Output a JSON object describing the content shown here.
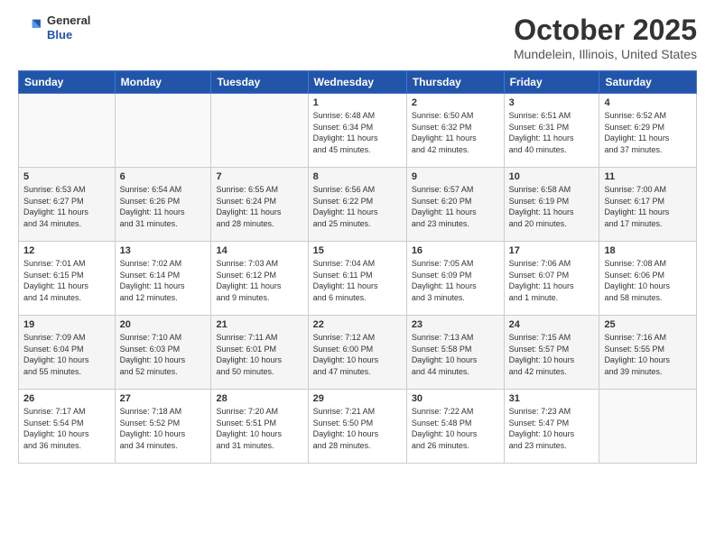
{
  "header": {
    "logo_general": "General",
    "logo_blue": "Blue",
    "month_title": "October 2025",
    "location": "Mundelein, Illinois, United States"
  },
  "days_of_week": [
    "Sunday",
    "Monday",
    "Tuesday",
    "Wednesday",
    "Thursday",
    "Friday",
    "Saturday"
  ],
  "weeks": [
    [
      {
        "day": "",
        "info": ""
      },
      {
        "day": "",
        "info": ""
      },
      {
        "day": "",
        "info": ""
      },
      {
        "day": "1",
        "info": "Sunrise: 6:48 AM\nSunset: 6:34 PM\nDaylight: 11 hours\nand 45 minutes."
      },
      {
        "day": "2",
        "info": "Sunrise: 6:50 AM\nSunset: 6:32 PM\nDaylight: 11 hours\nand 42 minutes."
      },
      {
        "day": "3",
        "info": "Sunrise: 6:51 AM\nSunset: 6:31 PM\nDaylight: 11 hours\nand 40 minutes."
      },
      {
        "day": "4",
        "info": "Sunrise: 6:52 AM\nSunset: 6:29 PM\nDaylight: 11 hours\nand 37 minutes."
      }
    ],
    [
      {
        "day": "5",
        "info": "Sunrise: 6:53 AM\nSunset: 6:27 PM\nDaylight: 11 hours\nand 34 minutes."
      },
      {
        "day": "6",
        "info": "Sunrise: 6:54 AM\nSunset: 6:26 PM\nDaylight: 11 hours\nand 31 minutes."
      },
      {
        "day": "7",
        "info": "Sunrise: 6:55 AM\nSunset: 6:24 PM\nDaylight: 11 hours\nand 28 minutes."
      },
      {
        "day": "8",
        "info": "Sunrise: 6:56 AM\nSunset: 6:22 PM\nDaylight: 11 hours\nand 25 minutes."
      },
      {
        "day": "9",
        "info": "Sunrise: 6:57 AM\nSunset: 6:20 PM\nDaylight: 11 hours\nand 23 minutes."
      },
      {
        "day": "10",
        "info": "Sunrise: 6:58 AM\nSunset: 6:19 PM\nDaylight: 11 hours\nand 20 minutes."
      },
      {
        "day": "11",
        "info": "Sunrise: 7:00 AM\nSunset: 6:17 PM\nDaylight: 11 hours\nand 17 minutes."
      }
    ],
    [
      {
        "day": "12",
        "info": "Sunrise: 7:01 AM\nSunset: 6:15 PM\nDaylight: 11 hours\nand 14 minutes."
      },
      {
        "day": "13",
        "info": "Sunrise: 7:02 AM\nSunset: 6:14 PM\nDaylight: 11 hours\nand 12 minutes."
      },
      {
        "day": "14",
        "info": "Sunrise: 7:03 AM\nSunset: 6:12 PM\nDaylight: 11 hours\nand 9 minutes."
      },
      {
        "day": "15",
        "info": "Sunrise: 7:04 AM\nSunset: 6:11 PM\nDaylight: 11 hours\nand 6 minutes."
      },
      {
        "day": "16",
        "info": "Sunrise: 7:05 AM\nSunset: 6:09 PM\nDaylight: 11 hours\nand 3 minutes."
      },
      {
        "day": "17",
        "info": "Sunrise: 7:06 AM\nSunset: 6:07 PM\nDaylight: 11 hours\nand 1 minute."
      },
      {
        "day": "18",
        "info": "Sunrise: 7:08 AM\nSunset: 6:06 PM\nDaylight: 10 hours\nand 58 minutes."
      }
    ],
    [
      {
        "day": "19",
        "info": "Sunrise: 7:09 AM\nSunset: 6:04 PM\nDaylight: 10 hours\nand 55 minutes."
      },
      {
        "day": "20",
        "info": "Sunrise: 7:10 AM\nSunset: 6:03 PM\nDaylight: 10 hours\nand 52 minutes."
      },
      {
        "day": "21",
        "info": "Sunrise: 7:11 AM\nSunset: 6:01 PM\nDaylight: 10 hours\nand 50 minutes."
      },
      {
        "day": "22",
        "info": "Sunrise: 7:12 AM\nSunset: 6:00 PM\nDaylight: 10 hours\nand 47 minutes."
      },
      {
        "day": "23",
        "info": "Sunrise: 7:13 AM\nSunset: 5:58 PM\nDaylight: 10 hours\nand 44 minutes."
      },
      {
        "day": "24",
        "info": "Sunrise: 7:15 AM\nSunset: 5:57 PM\nDaylight: 10 hours\nand 42 minutes."
      },
      {
        "day": "25",
        "info": "Sunrise: 7:16 AM\nSunset: 5:55 PM\nDaylight: 10 hours\nand 39 minutes."
      }
    ],
    [
      {
        "day": "26",
        "info": "Sunrise: 7:17 AM\nSunset: 5:54 PM\nDaylight: 10 hours\nand 36 minutes."
      },
      {
        "day": "27",
        "info": "Sunrise: 7:18 AM\nSunset: 5:52 PM\nDaylight: 10 hours\nand 34 minutes."
      },
      {
        "day": "28",
        "info": "Sunrise: 7:20 AM\nSunset: 5:51 PM\nDaylight: 10 hours\nand 31 minutes."
      },
      {
        "day": "29",
        "info": "Sunrise: 7:21 AM\nSunset: 5:50 PM\nDaylight: 10 hours\nand 28 minutes."
      },
      {
        "day": "30",
        "info": "Sunrise: 7:22 AM\nSunset: 5:48 PM\nDaylight: 10 hours\nand 26 minutes."
      },
      {
        "day": "31",
        "info": "Sunrise: 7:23 AM\nSunset: 5:47 PM\nDaylight: 10 hours\nand 23 minutes."
      },
      {
        "day": "",
        "info": ""
      }
    ]
  ]
}
